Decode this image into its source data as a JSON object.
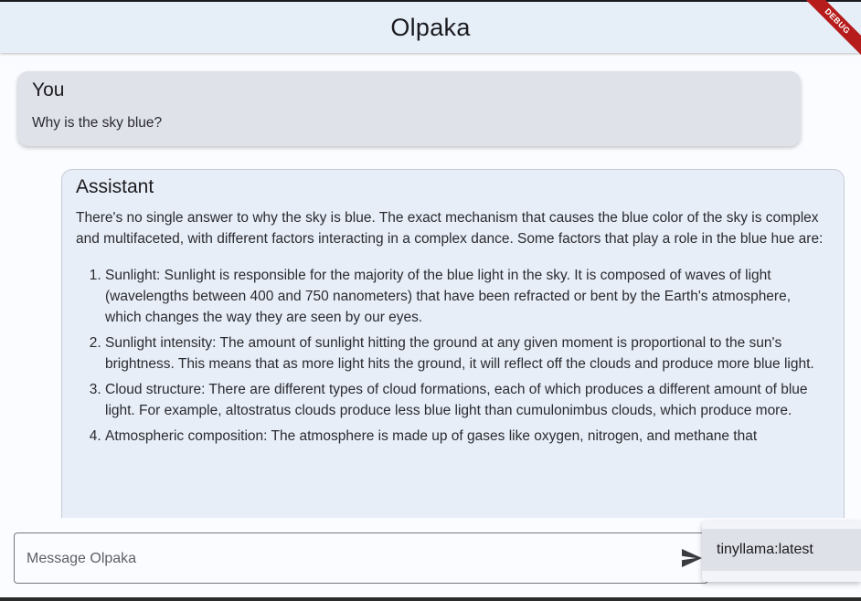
{
  "appbar": {
    "title": "Olpaka",
    "debug_banner": "DEBUG"
  },
  "messages": {
    "user": {
      "sender": "You",
      "text": "Why is the sky blue?"
    },
    "assistant": {
      "sender": "Assistant",
      "intro": "There's no single answer to why the sky is blue. The exact mechanism that causes the blue color of the sky is complex and multifaceted, with different factors interacting in a complex dance. Some factors that play a role in the blue hue are:",
      "points": [
        "Sunlight: Sunlight is responsible for the majority of the blue light in the sky. It is composed of waves of light (wavelengths between 400 and 750 nanometers) that have been refracted or bent by the Earth's atmosphere, which changes the way they are seen by our eyes.",
        "Sunlight intensity: The amount of sunlight hitting the ground at any given moment is proportional to the sun's brightness. This means that as more light hits the ground, it will reflect off the clouds and produce more blue light.",
        "Cloud structure: There are different types of cloud formations, each of which produces a different amount of blue light. For example, altostratus clouds produce less blue light than cumulonimbus clouds, which produce more.",
        "Atmospheric composition: The atmosphere is made up of gases like oxygen, nitrogen, and methane that"
      ]
    }
  },
  "composer": {
    "placeholder": "Message Olpaka",
    "send_icon": "send-icon"
  },
  "model_menu": {
    "selected": "tinyllama:latest"
  },
  "colors": {
    "appbar_bg": "#e6eef8",
    "user_bubble": "#e0e2ea",
    "assistant_bubble": "#e8eef7",
    "debug_banner": "#b71c1c"
  }
}
